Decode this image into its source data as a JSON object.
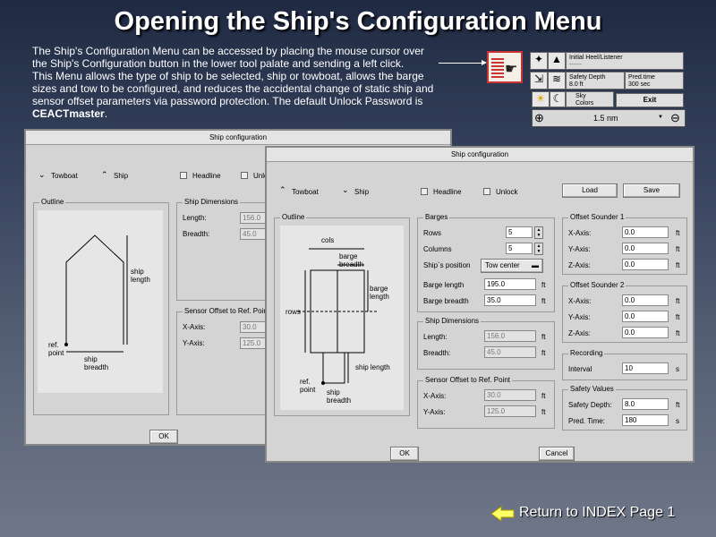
{
  "title": "Opening the Ship's Configuration Menu",
  "intro": {
    "line1": "The Ship's Configuration Menu can be accessed by placing the mouse cursor over",
    "line2": "the Ship's Configuration button in the lower tool palate and sending a left click.",
    "line3": "This Menu allows the type of ship to be selected, ship or towboat, allows the barge",
    "line4": "sizes and tow to be configured, and reduces the accidental change of static ship and",
    "line5": "sensor offset parameters via password protection.  The default Unlock Password is",
    "password": "CEACTmaster",
    "period": "."
  },
  "palette": {
    "field1_label": "Initial Heel/Listener",
    "field2_label": "Safety Depth",
    "field2_value": "8.0 ft",
    "field3_label": "Pred.time",
    "field3_value": "300 sec",
    "field4_label": "Sky",
    "field4_value": "Colors",
    "exit_label": "Exit",
    "zoom_value": "1.5 nm"
  },
  "back_dialog": {
    "title": "Ship configuration",
    "radio_towboat": "Towboat",
    "radio_ship": "Ship",
    "chk_headline": "Headline",
    "chk_unlock": "Unlo",
    "outline_label": "Outline",
    "ship_dims_label": "Ship Dimensions",
    "length_label": "Length:",
    "length_value": "156.0",
    "breadth_label": "Breadth:",
    "breadth_value": "45.0",
    "sensor_label": "Sensor Offset to Ref. Poin",
    "xaxis_label": "X-Axis:",
    "xaxis_value": "30.0",
    "yaxis_label": "Y-Axis:",
    "yaxis_value": "125.0",
    "ok_label": "OK",
    "diag_ship_length": "ship\nlength",
    "diag_ref_point": "ref.\npoint",
    "diag_ship_breadth": "ship\nbreadth"
  },
  "front_dialog": {
    "title": "Ship configuration",
    "radio_towboat": "Towboat",
    "radio_ship": "Ship",
    "chk_headline": "Headline",
    "chk_unlock": "Unlock",
    "load_label": "Load",
    "save_label": "Save",
    "outline_label": "Outline",
    "diag_cols": "cols",
    "diag_barge_breadth": "barge\nbreadth",
    "diag_barge_length": "barge\nlength",
    "diag_rows": "rows",
    "diag_ship_length": "ship length",
    "diag_ref_point": "ref.\npoint",
    "diag_ship_breadth": "ship\nbreadth",
    "barges_label": "Barges",
    "rows_label": "Rows",
    "rows_value": "5",
    "columns_label": "Columns",
    "columns_value": "5",
    "ship_pos_label": "Ship`s position",
    "ship_pos_value": "Tow center",
    "barge_length_label": "Barge length",
    "barge_length_value": "195.0",
    "barge_breadth_label": "Barge breadth",
    "barge_breadth_value": "35.0",
    "unit_ft": "ft",
    "ship_dims_label": "Ship Dimensions",
    "length_label": "Length:",
    "length_value": "156.0",
    "breadth_label": "Breadth:",
    "breadth_value": "45.0",
    "sensor_label": "Sensor Offset to Ref. Point",
    "sx_label": "X-Axis:",
    "sx_value": "30.0",
    "sy_label": "Y-Axis:",
    "sy_value": "125.0",
    "os1_label": "Offset Sounder 1",
    "os1_x_label": "X-Axis:",
    "os1_x_value": "0.0",
    "os1_y_label": "Y-Axis:",
    "os1_y_value": "0.0",
    "os1_z_label": "Z-Axis:",
    "os1_z_value": "0.0",
    "os2_label": "Offset Sounder 2",
    "os2_x_label": "X-Axis:",
    "os2_x_value": "0.0",
    "os2_y_label": "Y-Axis:",
    "os2_y_value": "0.0",
    "os2_z_label": "Z-Axis:",
    "os2_z_value": "0.0",
    "recording_label": "Recording",
    "interval_label": "Interval",
    "interval_value": "10",
    "unit_s": "s",
    "safety_label": "Safety Values",
    "safety_depth_label": "Safety Depth:",
    "safety_depth_value": "8.0",
    "pred_time_label": "Pred. Time:",
    "pred_time_value": "180",
    "ok_label": "OK",
    "cancel_label": "Cancel"
  },
  "return_link": "Return to INDEX Page 1",
  "colors": {
    "highlight": "#c33333",
    "arrow": "#ffff66"
  }
}
